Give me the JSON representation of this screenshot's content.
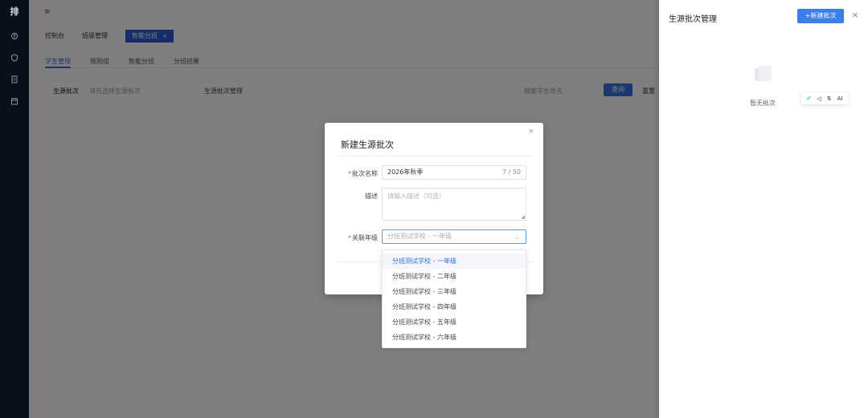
{
  "nav": {
    "logo": "排",
    "icons": [
      "brain-icon",
      "shield-icon",
      "document-icon",
      "calendar-icon"
    ]
  },
  "main": {
    "tabs": [
      {
        "label": "控制台"
      },
      {
        "label": "班级管理"
      },
      {
        "label": "智能分班"
      }
    ],
    "subtabs": [
      {
        "label": "学生管理"
      },
      {
        "label": "规则组"
      },
      {
        "label": "智能分班"
      },
      {
        "label": "分班结果"
      }
    ],
    "filter": {
      "batch_label": "生源批次",
      "batch_placeholder": "请先选择生源批次",
      "manage_label": "生源批次管理",
      "search_placeholder": "搜索学生姓名",
      "search_button": "查询",
      "reset_button": "重置"
    }
  },
  "drawer": {
    "title": "生源批次管理",
    "new_button": "+新建批次",
    "close": "×",
    "empty_text": "暂无批次",
    "ai_bar": {
      "items": [
        "✐",
        "◁",
        "⇅",
        "AI"
      ]
    }
  },
  "modal": {
    "title": "新建生源批次",
    "close": "×",
    "name_label": "批次名称",
    "name_value": "2026年秋季",
    "name_count": "7 / 50",
    "desc_label": "描述",
    "desc_placeholder": "请输入描述（可选）",
    "grade_label": "关联年级",
    "grade_placeholder": "分班测试学校 - 一年级",
    "required_mark": "*"
  },
  "dropdown": {
    "options": [
      {
        "label": "分班测试学校 - 一年级",
        "selected": true
      },
      {
        "label": "分班测试学校 - 二年级"
      },
      {
        "label": "分班测试学校 - 三年级"
      },
      {
        "label": "分班测试学校 - 四年级"
      },
      {
        "label": "分班测试学校 - 五年级"
      },
      {
        "label": "分班测试学校 - 六年级"
      }
    ]
  },
  "colors": {
    "primary": "#2b6fde",
    "nav_bg": "#0a0f1c",
    "required": "#e54b4b"
  }
}
